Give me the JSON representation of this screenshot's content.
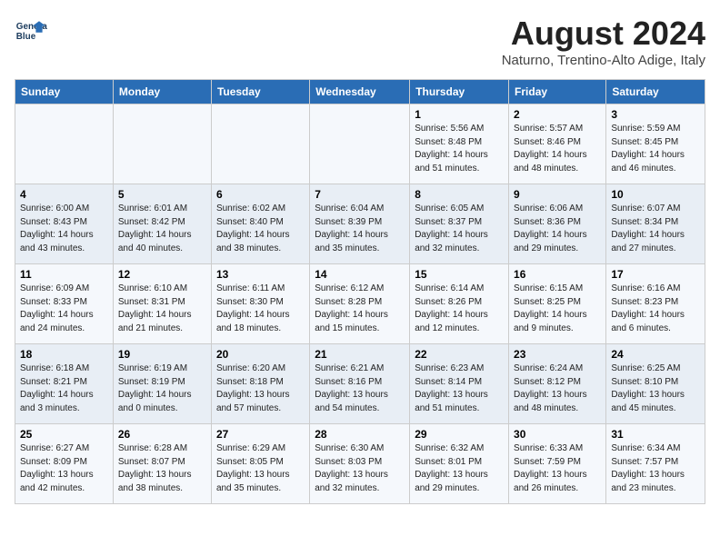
{
  "header": {
    "logo_line1": "General",
    "logo_line2": "Blue",
    "title": "August 2024",
    "subtitle": "Naturno, Trentino-Alto Adige, Italy"
  },
  "days_of_week": [
    "Sunday",
    "Monday",
    "Tuesday",
    "Wednesday",
    "Thursday",
    "Friday",
    "Saturday"
  ],
  "weeks": [
    [
      {
        "day": "",
        "info": ""
      },
      {
        "day": "",
        "info": ""
      },
      {
        "day": "",
        "info": ""
      },
      {
        "day": "",
        "info": ""
      },
      {
        "day": "1",
        "info": "Sunrise: 5:56 AM\nSunset: 8:48 PM\nDaylight: 14 hours\nand 51 minutes."
      },
      {
        "day": "2",
        "info": "Sunrise: 5:57 AM\nSunset: 8:46 PM\nDaylight: 14 hours\nand 48 minutes."
      },
      {
        "day": "3",
        "info": "Sunrise: 5:59 AM\nSunset: 8:45 PM\nDaylight: 14 hours\nand 46 minutes."
      }
    ],
    [
      {
        "day": "4",
        "info": "Sunrise: 6:00 AM\nSunset: 8:43 PM\nDaylight: 14 hours\nand 43 minutes."
      },
      {
        "day": "5",
        "info": "Sunrise: 6:01 AM\nSunset: 8:42 PM\nDaylight: 14 hours\nand 40 minutes."
      },
      {
        "day": "6",
        "info": "Sunrise: 6:02 AM\nSunset: 8:40 PM\nDaylight: 14 hours\nand 38 minutes."
      },
      {
        "day": "7",
        "info": "Sunrise: 6:04 AM\nSunset: 8:39 PM\nDaylight: 14 hours\nand 35 minutes."
      },
      {
        "day": "8",
        "info": "Sunrise: 6:05 AM\nSunset: 8:37 PM\nDaylight: 14 hours\nand 32 minutes."
      },
      {
        "day": "9",
        "info": "Sunrise: 6:06 AM\nSunset: 8:36 PM\nDaylight: 14 hours\nand 29 minutes."
      },
      {
        "day": "10",
        "info": "Sunrise: 6:07 AM\nSunset: 8:34 PM\nDaylight: 14 hours\nand 27 minutes."
      }
    ],
    [
      {
        "day": "11",
        "info": "Sunrise: 6:09 AM\nSunset: 8:33 PM\nDaylight: 14 hours\nand 24 minutes."
      },
      {
        "day": "12",
        "info": "Sunrise: 6:10 AM\nSunset: 8:31 PM\nDaylight: 14 hours\nand 21 minutes."
      },
      {
        "day": "13",
        "info": "Sunrise: 6:11 AM\nSunset: 8:30 PM\nDaylight: 14 hours\nand 18 minutes."
      },
      {
        "day": "14",
        "info": "Sunrise: 6:12 AM\nSunset: 8:28 PM\nDaylight: 14 hours\nand 15 minutes."
      },
      {
        "day": "15",
        "info": "Sunrise: 6:14 AM\nSunset: 8:26 PM\nDaylight: 14 hours\nand 12 minutes."
      },
      {
        "day": "16",
        "info": "Sunrise: 6:15 AM\nSunset: 8:25 PM\nDaylight: 14 hours\nand 9 minutes."
      },
      {
        "day": "17",
        "info": "Sunrise: 6:16 AM\nSunset: 8:23 PM\nDaylight: 14 hours\nand 6 minutes."
      }
    ],
    [
      {
        "day": "18",
        "info": "Sunrise: 6:18 AM\nSunset: 8:21 PM\nDaylight: 14 hours\nand 3 minutes."
      },
      {
        "day": "19",
        "info": "Sunrise: 6:19 AM\nSunset: 8:19 PM\nDaylight: 14 hours\nand 0 minutes."
      },
      {
        "day": "20",
        "info": "Sunrise: 6:20 AM\nSunset: 8:18 PM\nDaylight: 13 hours\nand 57 minutes."
      },
      {
        "day": "21",
        "info": "Sunrise: 6:21 AM\nSunset: 8:16 PM\nDaylight: 13 hours\nand 54 minutes."
      },
      {
        "day": "22",
        "info": "Sunrise: 6:23 AM\nSunset: 8:14 PM\nDaylight: 13 hours\nand 51 minutes."
      },
      {
        "day": "23",
        "info": "Sunrise: 6:24 AM\nSunset: 8:12 PM\nDaylight: 13 hours\nand 48 minutes."
      },
      {
        "day": "24",
        "info": "Sunrise: 6:25 AM\nSunset: 8:10 PM\nDaylight: 13 hours\nand 45 minutes."
      }
    ],
    [
      {
        "day": "25",
        "info": "Sunrise: 6:27 AM\nSunset: 8:09 PM\nDaylight: 13 hours\nand 42 minutes."
      },
      {
        "day": "26",
        "info": "Sunrise: 6:28 AM\nSunset: 8:07 PM\nDaylight: 13 hours\nand 38 minutes."
      },
      {
        "day": "27",
        "info": "Sunrise: 6:29 AM\nSunset: 8:05 PM\nDaylight: 13 hours\nand 35 minutes."
      },
      {
        "day": "28",
        "info": "Sunrise: 6:30 AM\nSunset: 8:03 PM\nDaylight: 13 hours\nand 32 minutes."
      },
      {
        "day": "29",
        "info": "Sunrise: 6:32 AM\nSunset: 8:01 PM\nDaylight: 13 hours\nand 29 minutes."
      },
      {
        "day": "30",
        "info": "Sunrise: 6:33 AM\nSunset: 7:59 PM\nDaylight: 13 hours\nand 26 minutes."
      },
      {
        "day": "31",
        "info": "Sunrise: 6:34 AM\nSunset: 7:57 PM\nDaylight: 13 hours\nand 23 minutes."
      }
    ]
  ]
}
